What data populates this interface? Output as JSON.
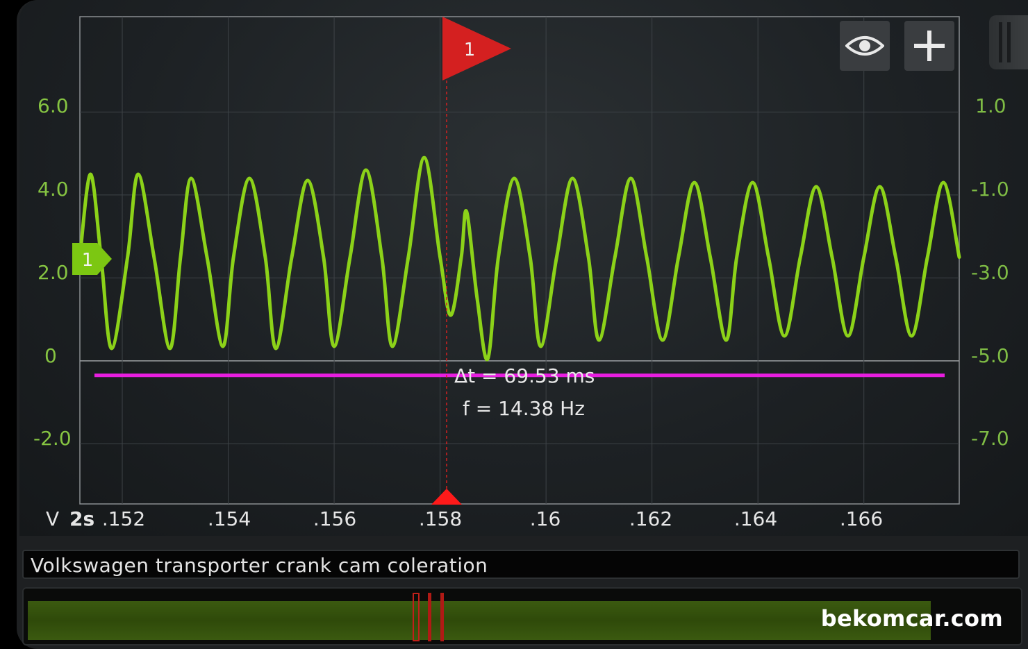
{
  "scope": {
    "left_axis": {
      "unit": "V",
      "ticks": [
        "6.0",
        "4.0",
        "2.0",
        "0",
        "-2.0"
      ]
    },
    "right_axis": {
      "ticks": [
        "1.0",
        "-1.0",
        "-3.0",
        "-5.0",
        "-7.0"
      ]
    },
    "time_axis": {
      "timebase": "2s",
      "ticks": [
        ".152",
        ".154",
        ".156",
        ".158",
        ".16",
        ".162",
        ".164",
        ".166"
      ]
    },
    "marker_flag_label": "1",
    "channel_label": "1",
    "measurement": {
      "delta_t": "Δt = 69.53 ms",
      "frequency": "f = 14.38 Hz"
    },
    "colors": {
      "trace": "#8cd219",
      "marker": "#d42020",
      "reference_line": "#e81ee0"
    }
  },
  "toolbar": {
    "visibility_icon": "eye-icon",
    "add_icon": "plus-icon"
  },
  "recording_title": "Volkswagen transporter crank cam coleration",
  "watermark": "bekomcar.com",
  "chart_data": {
    "type": "line",
    "title": "",
    "xlabel": "",
    "ylabel": "V",
    "xlim": [
      0.1512,
      0.1678
    ],
    "ylim": [
      -3.45,
      8.3
    ],
    "series": [
      {
        "points": [
          [
            0.1512,
            2.5
          ],
          [
            0.1514,
            4.5
          ],
          [
            0.1516,
            2.5
          ],
          [
            0.1518,
            0.3
          ],
          [
            0.1521,
            2.5
          ],
          [
            0.1523,
            4.5
          ],
          [
            0.1526,
            2.5
          ],
          [
            0.1529,
            0.3
          ],
          [
            0.1531,
            2.5
          ],
          [
            0.1533,
            4.4
          ],
          [
            0.1536,
            2.5
          ],
          [
            0.1539,
            0.35
          ],
          [
            0.1541,
            2.5
          ],
          [
            0.1544,
            4.4
          ],
          [
            0.1547,
            2.5
          ],
          [
            0.1549,
            0.3
          ],
          [
            0.1552,
            2.5
          ],
          [
            0.1555,
            4.35
          ],
          [
            0.1558,
            2.5
          ],
          [
            0.156,
            0.35
          ],
          [
            0.1563,
            2.5
          ],
          [
            0.1566,
            4.6
          ],
          [
            0.1569,
            2.5
          ],
          [
            0.1571,
            0.35
          ],
          [
            0.1574,
            2.5
          ],
          [
            0.1577,
            4.9
          ],
          [
            0.158,
            2.5
          ],
          [
            0.1582,
            1.1
          ],
          [
            0.1584,
            2.5
          ],
          [
            0.1585,
            3.6
          ],
          [
            0.1587,
            1.5
          ],
          [
            0.1589,
            0.05
          ],
          [
            0.1591,
            2.5
          ],
          [
            0.1594,
            4.4
          ],
          [
            0.1597,
            2.5
          ],
          [
            0.1599,
            0.35
          ],
          [
            0.1602,
            2.5
          ],
          [
            0.1605,
            4.4
          ],
          [
            0.1608,
            2.5
          ],
          [
            0.161,
            0.5
          ],
          [
            0.1613,
            2.5
          ],
          [
            0.1616,
            4.4
          ],
          [
            0.1619,
            2.5
          ],
          [
            0.1622,
            0.5
          ],
          [
            0.1625,
            2.5
          ],
          [
            0.1628,
            4.3
          ],
          [
            0.1631,
            2.5
          ],
          [
            0.1634,
            0.5
          ],
          [
            0.1636,
            2.5
          ],
          [
            0.1639,
            4.3
          ],
          [
            0.1642,
            2.5
          ],
          [
            0.1645,
            0.6
          ],
          [
            0.1648,
            2.5
          ],
          [
            0.1651,
            4.2
          ],
          [
            0.1654,
            2.5
          ],
          [
            0.1657,
            0.6
          ],
          [
            0.166,
            2.5
          ],
          [
            0.1663,
            4.2
          ],
          [
            0.1666,
            2.5
          ],
          [
            0.1669,
            0.6
          ],
          [
            0.1672,
            2.5
          ],
          [
            0.1675,
            4.3
          ],
          [
            0.1678,
            2.5
          ]
        ]
      }
    ],
    "ref_line_y": -0.35,
    "cursor_x": 0.1584,
    "channel_marker_y": 2.5,
    "grid": true
  }
}
